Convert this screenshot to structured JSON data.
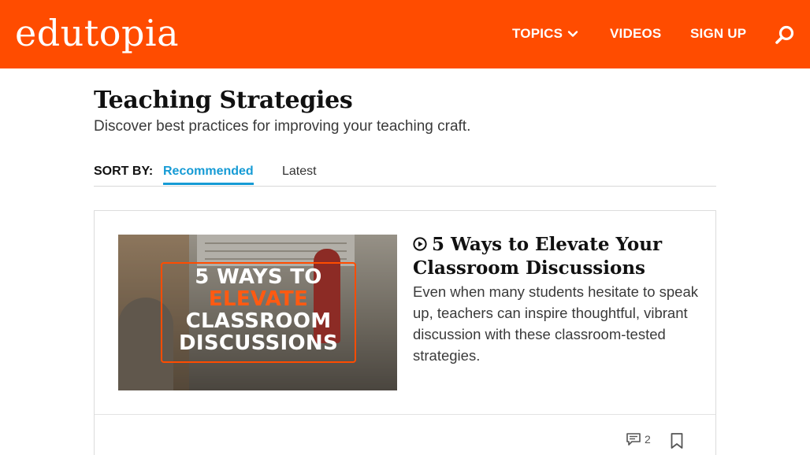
{
  "header": {
    "logo": "edutopia",
    "nav": {
      "topics": "TOPICS",
      "videos": "VIDEOS",
      "signup": "SIGN UP"
    },
    "icons": {
      "topics_chevron": "chevron-down-icon",
      "search": "search-icon"
    },
    "brand_color": "#ff4c00"
  },
  "page": {
    "title": "Teaching Strategies",
    "subtitle": "Discover best practices for improving your teaching craft."
  },
  "sort": {
    "label": "SORT BY:",
    "options": [
      "Recommended",
      "Latest"
    ],
    "selected": "Recommended",
    "accent_color": "#169bd5"
  },
  "article": {
    "thumbnail_text": {
      "line1": "5 WAYS TO",
      "line2": "ELEVATE",
      "line3": "CLASSROOM",
      "line4": "DISCUSSIONS"
    },
    "title_icon": "play-circle-icon",
    "title": "5 Ways to Elevate Your Classroom Discussions",
    "description": "Even when many students hesitate to speak up, teachers can inspire thoughtful, vibrant discussion with these classroom-tested strategies.",
    "comment_count": "2",
    "footer_icons": {
      "comments": "comment-icon",
      "bookmark": "bookmark-icon"
    }
  }
}
